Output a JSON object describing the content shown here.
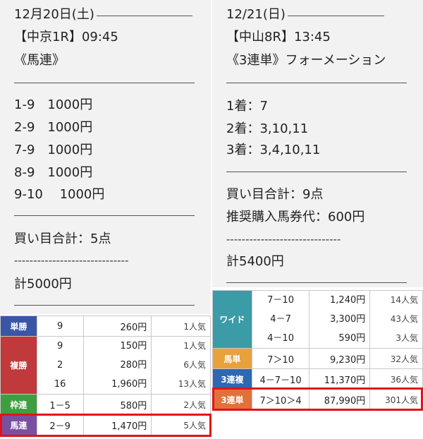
{
  "left": {
    "date": "12月20日(土)",
    "race": "【中京1R】09:45",
    "bet_type": "《馬連》",
    "bets": [
      "1-9　1000円",
      "2-9　1000円",
      "7-9　1000円",
      "8-9　1000円",
      "9-10　 1000円"
    ],
    "total_points": "買い目合計：5点",
    "dashes": "------------------------------",
    "total": "計5000円"
  },
  "right": {
    "date": "12/21(日)",
    "race": "【中山8R】13:45",
    "bet_type": "《3連単》フォーメーション",
    "first": "1着：7",
    "second": "2着：3,10,11",
    "third": "3着：3,4,10,11",
    "total_points": "買い目合計：9点",
    "recommended": "推奨購入馬券代：600円",
    "dashes": "------------------------------",
    "total": "計5400円"
  },
  "left_results": {
    "tansho": {
      "label": "単勝",
      "num": "9",
      "pay": "260円",
      "pop": "1人気"
    },
    "fukusho": {
      "label": "複勝",
      "nums": [
        "9",
        "2",
        "16"
      ],
      "pays": [
        "150円",
        "280円",
        "1,960円"
      ],
      "pops": [
        "1人気",
        "6人気",
        "13人気"
      ]
    },
    "wakuren": {
      "label": "枠連",
      "num": "1－5",
      "pay": "580円",
      "pop": "2人気"
    },
    "umaren": {
      "label": "馬連",
      "num": "2－9",
      "pay": "1,470円",
      "pop": "5人気"
    }
  },
  "right_results": {
    "wide": {
      "label": "ワイド",
      "nums": [
        "7－10",
        "4－7",
        "4－10"
      ],
      "pays": [
        "1,240円",
        "3,300円",
        "590円"
      ],
      "pops": [
        "14人気",
        "43人気",
        "3人気"
      ]
    },
    "umatan": {
      "label": "馬単",
      "num": "7＞10",
      "pay": "9,230円",
      "pop": "32人気"
    },
    "sanrenpuku": {
      "label": "3連複",
      "num": "4－7－10",
      "pay": "11,370円",
      "pop": "36人気"
    },
    "sanrentan": {
      "label": "3連単",
      "num": "7＞10＞4",
      "pay": "87,990円",
      "pop": "301人気"
    }
  },
  "colors": {
    "tansho": "#3a55a5",
    "fukusho": "#c0393b",
    "wakuren": "#3f9e3f",
    "umaren": "#7a4f9f",
    "wide": "#3b9ba6",
    "umatan": "#e9a13b",
    "sanrenpuku": "#2f67b0",
    "sanrentan": "#e2703a",
    "highlight": "#e0141a"
  }
}
